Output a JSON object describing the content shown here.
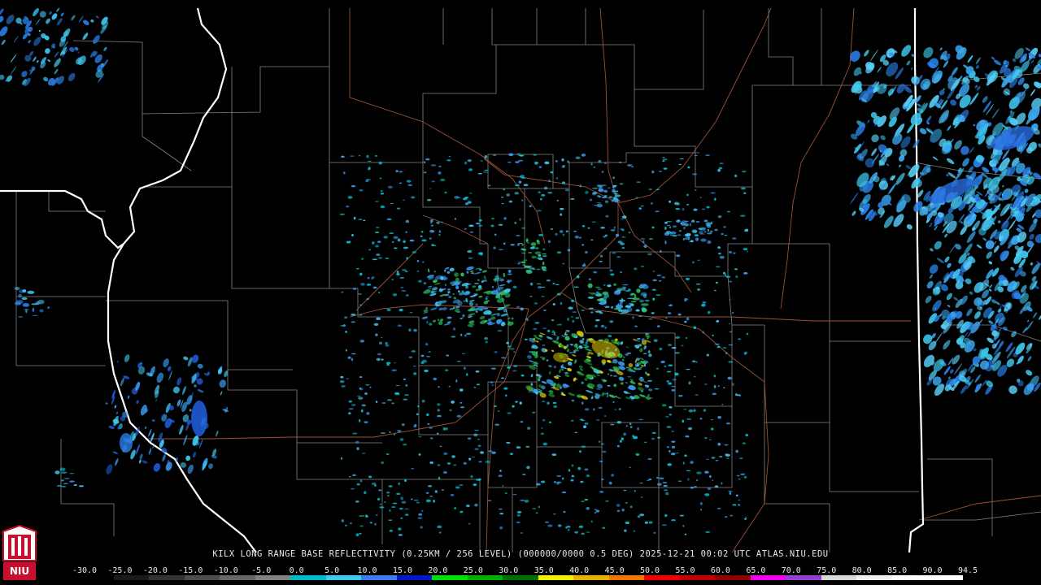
{
  "caption": "KILX LONG RANGE BASE REFLECTIVITY (0.25KM / 256 LEVEL) (000000/0000 0.5 DEG) 2025-12-21 00:02 UTC  ATLAS.NIU.EDU",
  "scale": {
    "labels": [
      "-30.0",
      "-25.0",
      "-20.0",
      "-15.0",
      "-10.0",
      "-5.0",
      "0.0",
      "5.0",
      "10.0",
      "15.0",
      "20.0",
      "25.0",
      "30.0",
      "35.0",
      "40.0",
      "45.0",
      "50.0",
      "55.0",
      "60.0",
      "65.0",
      "70.0",
      "75.0",
      "80.0",
      "85.0",
      "90.0",
      "94.5"
    ],
    "colors": [
      "#000000",
      "#1a1a1a",
      "#333333",
      "#4d4d4d",
      "#666666",
      "#808080",
      "#00b8c8",
      "#40c8f0",
      "#3a7cf0",
      "#0018c8",
      "#00e000",
      "#00b000",
      "#007000",
      "#f0f000",
      "#e8b000",
      "#f07800",
      "#f00000",
      "#c00000",
      "#900000",
      "#f000f0",
      "#9040d0",
      "#d8d8d8",
      "#f0f0f0",
      "#ffffff",
      "#ffffff"
    ]
  },
  "logo": {
    "text": "NIU",
    "colors": {
      "red": "#c8102e",
      "white": "#ffffff"
    }
  }
}
